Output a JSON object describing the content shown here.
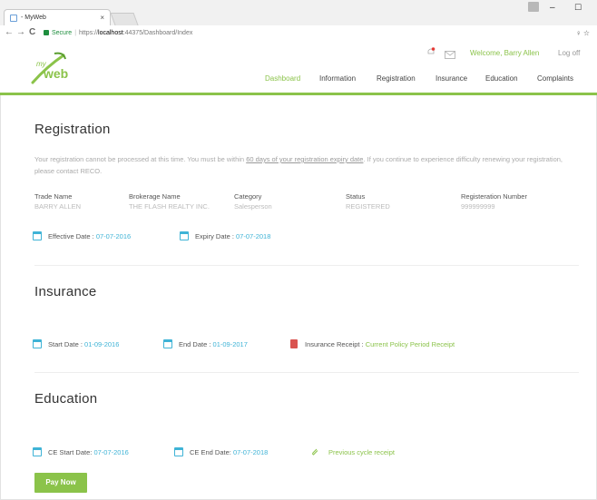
{
  "browser": {
    "tab_title": "- MyWeb",
    "tab_close": "×",
    "window_min": "–",
    "window_max": "☐",
    "nav_back": "←",
    "nav_forward": "→",
    "nav_reload": "C",
    "secure_label": "Secure",
    "url_scheme": "https://",
    "url_host": "localhost",
    "url_path": ":44375/Dashboard/Index",
    "addr_icons": "♀ ☆"
  },
  "header": {
    "logo_my": "my",
    "logo_web": "web",
    "welcome": "Welcome, Barry Allen",
    "logoff": "Log off",
    "nav": [
      {
        "label": "Dashboard",
        "active": true
      },
      {
        "label": "Information"
      },
      {
        "label": "Registration"
      },
      {
        "label": "Insurance"
      },
      {
        "label": "Education"
      },
      {
        "label": "Complaints"
      }
    ]
  },
  "registration": {
    "title": "Registration",
    "notice_before": "Your registration cannot be processed at this time. You must be within ",
    "notice_link": "60 days of your registration expiry date",
    "notice_after": ". If you continue to experience difficulty renewing your registration, please contact RECO.",
    "fields": [
      {
        "label": "Trade Name",
        "value": "BARRY ALLEN"
      },
      {
        "label": "Brokerage Name",
        "value": "THE FLASH REALTY INC."
      },
      {
        "label": "Category",
        "value": "Salesperson"
      },
      {
        "label": "Status",
        "value": "REGISTERED"
      },
      {
        "label": "Registeration Number",
        "value": "999999999"
      }
    ],
    "effective_label": "Effective Date : ",
    "effective_value": "07-07-2016",
    "expiry_label": "Expiry Date : ",
    "expiry_value": "07-07-2018"
  },
  "insurance": {
    "title": "Insurance",
    "start_label": "Start Date : ",
    "start_value": "01-09-2016",
    "end_label": "End Date : ",
    "end_value": "01-09-2017",
    "receipt_label": "Insurance Receipt : ",
    "receipt_value": "Current Policy Period Receipt"
  },
  "education": {
    "title": "Education",
    "ce_start_label": "CE Start Date: ",
    "ce_start_value": "07-07-2016",
    "ce_end_label": "CE End Date: ",
    "ce_end_value": "07-07-2018",
    "prev_receipt": "Previous cycle receipt",
    "pay_button": "Pay Now"
  },
  "colors": {
    "brand_green": "#8bc34a",
    "date_blue": "#3fb3d6",
    "pdf_red": "#d9534f"
  }
}
